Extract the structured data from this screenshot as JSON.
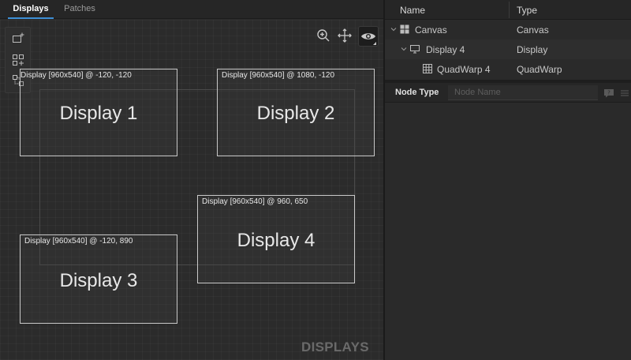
{
  "tabs": [
    {
      "label": "Displays",
      "active": true
    },
    {
      "label": "Patches",
      "active": false
    }
  ],
  "canvas": {
    "toolbar_icons": [
      "add-display-icon",
      "add-group-icon",
      "link-displays-icon"
    ],
    "view_icons": [
      "zoom-in-icon",
      "pan-icon",
      "eye-icon"
    ],
    "displays": [
      {
        "meta": "Display [960x540] @ -120, -120",
        "name": "Display 1"
      },
      {
        "meta": "Display [960x540] @ 1080, -120",
        "name": "Display 2"
      },
      {
        "meta": "Display [960x540] @ -120, 890",
        "name": "Display 3"
      },
      {
        "meta": "Display [960x540] @ 960, 650",
        "name": "Display 4"
      }
    ],
    "watermark": "DISPLAYS"
  },
  "tree": {
    "columns": {
      "name": "Name",
      "type": "Type"
    },
    "rows": [
      {
        "label": "Canvas",
        "type": "Canvas",
        "icon": "grid-icon",
        "expanded": true
      },
      {
        "label": "Display 4",
        "type": "Display",
        "icon": "monitor-icon",
        "expanded": true,
        "selected": true
      },
      {
        "label": "QuadWarp 4",
        "type": "QuadWarp",
        "icon": "quadwarp-grid-icon"
      }
    ]
  },
  "properties": {
    "node_type_label": "Node Type",
    "node_name_placeholder": "Node Name",
    "node_name_value": ""
  },
  "colors": {
    "accent": "#3d8fd6",
    "background": "#2a2a2a",
    "display_border": "#c9c9c9"
  }
}
